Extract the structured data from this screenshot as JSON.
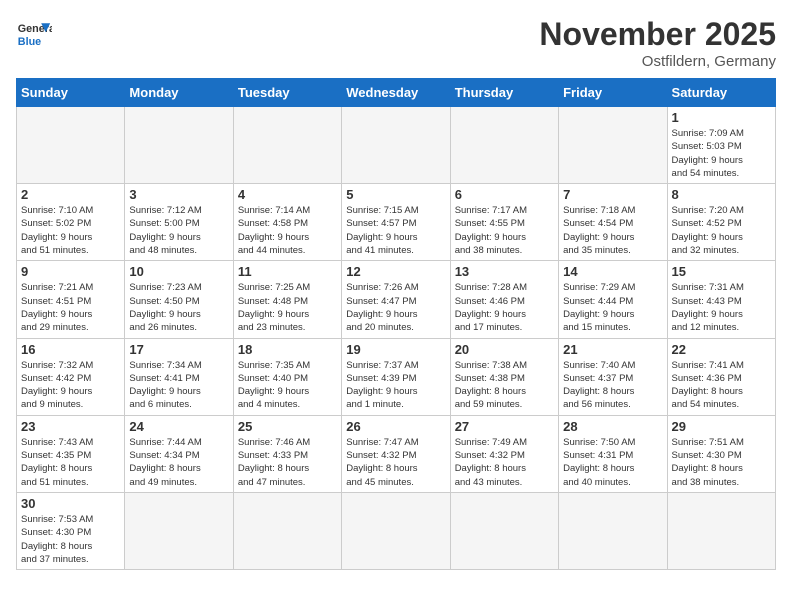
{
  "logo": {
    "general": "General",
    "blue": "Blue"
  },
  "header": {
    "month_year": "November 2025",
    "location": "Ostfildern, Germany"
  },
  "weekdays": [
    "Sunday",
    "Monday",
    "Tuesday",
    "Wednesday",
    "Thursday",
    "Friday",
    "Saturday"
  ],
  "weeks": [
    [
      {
        "day": "",
        "info": ""
      },
      {
        "day": "",
        "info": ""
      },
      {
        "day": "",
        "info": ""
      },
      {
        "day": "",
        "info": ""
      },
      {
        "day": "",
        "info": ""
      },
      {
        "day": "",
        "info": ""
      },
      {
        "day": "1",
        "info": "Sunrise: 7:09 AM\nSunset: 5:03 PM\nDaylight: 9 hours\nand 54 minutes."
      }
    ],
    [
      {
        "day": "2",
        "info": "Sunrise: 7:10 AM\nSunset: 5:02 PM\nDaylight: 9 hours\nand 51 minutes."
      },
      {
        "day": "3",
        "info": "Sunrise: 7:12 AM\nSunset: 5:00 PM\nDaylight: 9 hours\nand 48 minutes."
      },
      {
        "day": "4",
        "info": "Sunrise: 7:14 AM\nSunset: 4:58 PM\nDaylight: 9 hours\nand 44 minutes."
      },
      {
        "day": "5",
        "info": "Sunrise: 7:15 AM\nSunset: 4:57 PM\nDaylight: 9 hours\nand 41 minutes."
      },
      {
        "day": "6",
        "info": "Sunrise: 7:17 AM\nSunset: 4:55 PM\nDaylight: 9 hours\nand 38 minutes."
      },
      {
        "day": "7",
        "info": "Sunrise: 7:18 AM\nSunset: 4:54 PM\nDaylight: 9 hours\nand 35 minutes."
      },
      {
        "day": "8",
        "info": "Sunrise: 7:20 AM\nSunset: 4:52 PM\nDaylight: 9 hours\nand 32 minutes."
      }
    ],
    [
      {
        "day": "9",
        "info": "Sunrise: 7:21 AM\nSunset: 4:51 PM\nDaylight: 9 hours\nand 29 minutes."
      },
      {
        "day": "10",
        "info": "Sunrise: 7:23 AM\nSunset: 4:50 PM\nDaylight: 9 hours\nand 26 minutes."
      },
      {
        "day": "11",
        "info": "Sunrise: 7:25 AM\nSunset: 4:48 PM\nDaylight: 9 hours\nand 23 minutes."
      },
      {
        "day": "12",
        "info": "Sunrise: 7:26 AM\nSunset: 4:47 PM\nDaylight: 9 hours\nand 20 minutes."
      },
      {
        "day": "13",
        "info": "Sunrise: 7:28 AM\nSunset: 4:46 PM\nDaylight: 9 hours\nand 17 minutes."
      },
      {
        "day": "14",
        "info": "Sunrise: 7:29 AM\nSunset: 4:44 PM\nDaylight: 9 hours\nand 15 minutes."
      },
      {
        "day": "15",
        "info": "Sunrise: 7:31 AM\nSunset: 4:43 PM\nDaylight: 9 hours\nand 12 minutes."
      }
    ],
    [
      {
        "day": "16",
        "info": "Sunrise: 7:32 AM\nSunset: 4:42 PM\nDaylight: 9 hours\nand 9 minutes."
      },
      {
        "day": "17",
        "info": "Sunrise: 7:34 AM\nSunset: 4:41 PM\nDaylight: 9 hours\nand 6 minutes."
      },
      {
        "day": "18",
        "info": "Sunrise: 7:35 AM\nSunset: 4:40 PM\nDaylight: 9 hours\nand 4 minutes."
      },
      {
        "day": "19",
        "info": "Sunrise: 7:37 AM\nSunset: 4:39 PM\nDaylight: 9 hours\nand 1 minute."
      },
      {
        "day": "20",
        "info": "Sunrise: 7:38 AM\nSunset: 4:38 PM\nDaylight: 8 hours\nand 59 minutes."
      },
      {
        "day": "21",
        "info": "Sunrise: 7:40 AM\nSunset: 4:37 PM\nDaylight: 8 hours\nand 56 minutes."
      },
      {
        "day": "22",
        "info": "Sunrise: 7:41 AM\nSunset: 4:36 PM\nDaylight: 8 hours\nand 54 minutes."
      }
    ],
    [
      {
        "day": "23",
        "info": "Sunrise: 7:43 AM\nSunset: 4:35 PM\nDaylight: 8 hours\nand 51 minutes."
      },
      {
        "day": "24",
        "info": "Sunrise: 7:44 AM\nSunset: 4:34 PM\nDaylight: 8 hours\nand 49 minutes."
      },
      {
        "day": "25",
        "info": "Sunrise: 7:46 AM\nSunset: 4:33 PM\nDaylight: 8 hours\nand 47 minutes."
      },
      {
        "day": "26",
        "info": "Sunrise: 7:47 AM\nSunset: 4:32 PM\nDaylight: 8 hours\nand 45 minutes."
      },
      {
        "day": "27",
        "info": "Sunrise: 7:49 AM\nSunset: 4:32 PM\nDaylight: 8 hours\nand 43 minutes."
      },
      {
        "day": "28",
        "info": "Sunrise: 7:50 AM\nSunset: 4:31 PM\nDaylight: 8 hours\nand 40 minutes."
      },
      {
        "day": "29",
        "info": "Sunrise: 7:51 AM\nSunset: 4:30 PM\nDaylight: 8 hours\nand 38 minutes."
      }
    ],
    [
      {
        "day": "30",
        "info": "Sunrise: 7:53 AM\nSunset: 4:30 PM\nDaylight: 8 hours\nand 37 minutes."
      },
      {
        "day": "",
        "info": ""
      },
      {
        "day": "",
        "info": ""
      },
      {
        "day": "",
        "info": ""
      },
      {
        "day": "",
        "info": ""
      },
      {
        "day": "",
        "info": ""
      },
      {
        "day": "",
        "info": ""
      }
    ]
  ]
}
